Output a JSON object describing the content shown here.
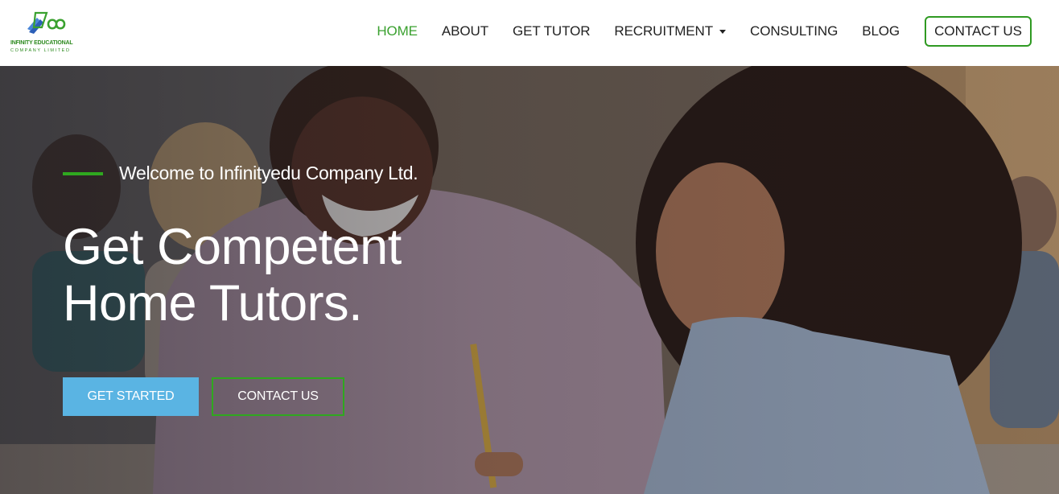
{
  "brand": {
    "name_line1": "INFINITY EDUCATIONAL",
    "name_line2": "COMPANY LIMITED",
    "logo_icon": "infinity-logo-icon",
    "color": "#2d8a1f"
  },
  "nav": {
    "items": [
      {
        "label": "HOME",
        "active": true
      },
      {
        "label": "ABOUT",
        "active": false
      },
      {
        "label": "GET TUTOR",
        "active": false
      },
      {
        "label": "RECRUITMENT",
        "active": false,
        "dropdown": true
      },
      {
        "label": "CONSULTING",
        "active": false
      },
      {
        "label": "BLOG",
        "active": false
      }
    ],
    "contact_label": "CONTACT US",
    "active_color": "#3aa12f"
  },
  "hero": {
    "welcome": "Welcome to Infinityedu Company Ltd.",
    "title_line1": "Get Competent",
    "title_line2": "Home Tutors.",
    "primary_button": "GET STARTED",
    "secondary_button": "CONTACT US",
    "accent_color": "#2fa81f",
    "button_color": "#5ab4e3",
    "background_image": "tutor-with-student-photo"
  }
}
